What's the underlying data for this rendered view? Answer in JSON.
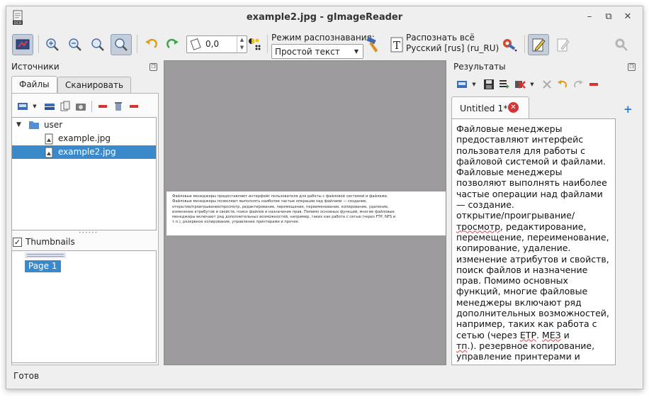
{
  "window": {
    "title": "example2.jpg - gImageReader",
    "controls": {
      "minimize": "–",
      "maximize": "⧉",
      "close": "✕"
    }
  },
  "toolbar": {
    "rotation_value": "0,0",
    "mode_label": "Режим распознавания:",
    "mode_value": "Простой текст",
    "recognize_line1": "Распознать всё",
    "recognize_line2": "Русский [rus] (ru_RU)"
  },
  "sources": {
    "title": "Источники",
    "tabs": [
      "Файлы",
      "Сканировать"
    ],
    "tree": {
      "folder": "user",
      "files": [
        "example.jpg",
        "example2.jpg"
      ],
      "selected_index": 1
    },
    "thumbnails_label": "Thumbnails",
    "thumbnails_checked": true,
    "thumbnail_page": "Page 1"
  },
  "document": {
    "lines": [
      "Файловые менеджеры предоставляют интерфейс пользователя для работы с файловой системой и файлами.",
      "Файловые менеджеры позволяют выполнять наиболее частые операции над файлами — создание,",
      "открытие/проигрывание/просмотр, редактирование, перемещение, переименование, копирование, удаление,",
      "изменение атрибутов и свойств, поиск файлов и назначение прав. Помимо основных функций, многие файловые",
      "менеджеры включают ряд дополнительных возможностей, например, таких как работа с сетью (через FTP, NFS и",
      "т.п.), резервное копирование, управление принтерами и прочее."
    ]
  },
  "results": {
    "title": "Результаты",
    "tab_label": "Untitled 1*",
    "add_tab": "+",
    "text": {
      "p1": "Файловые менеджеры предоставляют интерфейс пользователя для работы с файловой системой и файлами.",
      "p2": "Файловые менеджеры позволяют выполнять наиболее частые операции над файлами — создание.",
      "p3_pre": "открытие/проигрывание/",
      "p3_err": "тросмотр",
      "p3_post": ", редактирование, перемещение, переименование, копирование, удаление.",
      "p4_pre": "изменение атрибутов и свойств, поиск файлов и назначение прав. Помимо основных функций, многие файловые менеджеры включают ряд дополнительных возможностей, например, таких как работа с сетью (через ",
      "p4_err1": "ЕТР",
      "p4_mid": ". ",
      "p4_err2": "МЕЗ",
      "p4_post": " и",
      "p5_err": "тп",
      "p5_post": ".). резервное копирование, управление принтерами и прочее."
    }
  },
  "status": {
    "text": "Готов"
  },
  "colors": {
    "selection": "#3a8acb",
    "window_bg": "#efefef",
    "canvas_bg": "#9c9a9c"
  }
}
